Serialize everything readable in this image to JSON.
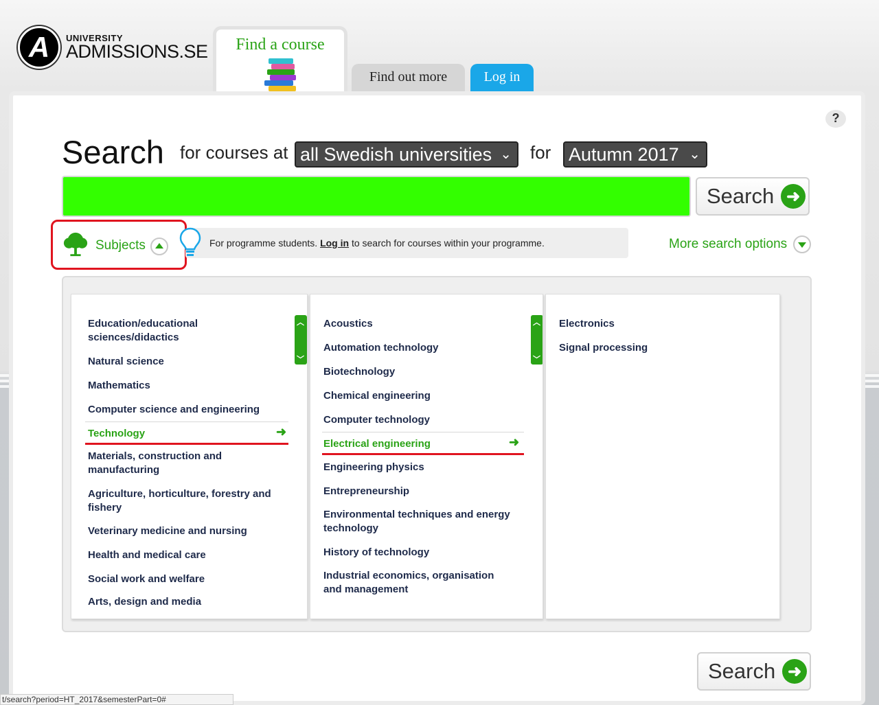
{
  "logo": {
    "badge": "A",
    "small": "UNIVERSITY",
    "big": "ADMISSIONS.SE"
  },
  "tabs": {
    "find": "Find a course",
    "more": "Find out more",
    "login": "Log in"
  },
  "help": "?",
  "search": {
    "title": "Search",
    "for_courses": "for courses at",
    "university_select": "all Swedish universities",
    "for": "for",
    "period_select": "Autumn 2017",
    "button": "Search"
  },
  "subjects": {
    "label": "Subjects"
  },
  "info": {
    "prefix": "For programme students.",
    "link": "Log in",
    "suffix": "to search for courses within your programme."
  },
  "more_options": "More search options",
  "columns": {
    "col1": [
      "Education/educational sciences/didactics",
      "Natural science",
      "Mathematics",
      "Computer science and engineering",
      "Technology",
      "Materials, construction and manufacturing",
      "Agriculture, horticulture, forestry and fishery",
      "Veterinary medicine and nursing",
      "Health and medical care",
      "Social work and welfare",
      "Arts, design and media"
    ],
    "col2": [
      "Acoustics",
      "Automation technology",
      "Biotechnology",
      "Chemical engineering",
      "Computer technology",
      "Electrical engineering",
      "Engineering physics",
      "Entrepreneurship",
      "Environmental techniques and energy technology",
      "History of technology",
      "Industrial economics, organisation and management"
    ],
    "col3": [
      "Electronics",
      "Signal processing"
    ]
  },
  "colors": {
    "accent": "#2aa316",
    "highlight": "#e0141f",
    "login_tab": "#1aa7e8",
    "search_field": "#33ff00"
  },
  "status_bar": "t/search?period=HT_2017&semesterPart=0#"
}
